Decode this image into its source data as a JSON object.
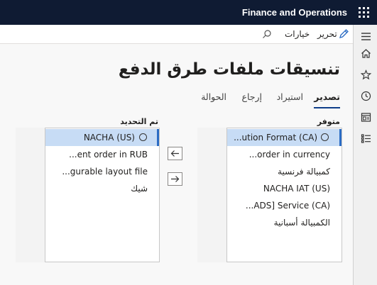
{
  "header": {
    "app_title": "Finance and Operations"
  },
  "actionbar": {
    "edit_label": "تحرير",
    "options_label": "خيارات"
  },
  "page": {
    "title": "تنسيقات ملفات طرق الدفع"
  },
  "tabs": [
    {
      "label": "تصدير",
      "active": true
    },
    {
      "label": "استيراد",
      "active": false
    },
    {
      "label": "إرجاع",
      "active": false
    },
    {
      "label": "الحوالة",
      "active": false
    }
  ],
  "available": {
    "label": "متوفر",
    "items": [
      {
        "text": "...ution Format (CA)",
        "selected": true
      },
      {
        "text": "...order in currency",
        "selected": false
      },
      {
        "text": "كمبيالة فرنسية",
        "selected": false
      },
      {
        "text": "NACHA IAT (US)",
        "selected": false
      },
      {
        "text": "...ADS] Service (CA)",
        "selected": false
      },
      {
        "text": "الكمبيالة أسبانية",
        "selected": false
      }
    ]
  },
  "setup": {
    "label": "تم التحديد",
    "items": [
      {
        "text": "NACHA (US)",
        "selected": true
      },
      {
        "text": "...ent order in RUB",
        "selected": false
      },
      {
        "text": "...gurable layout file",
        "selected": false
      },
      {
        "text": "شيك",
        "selected": false
      }
    ]
  },
  "icons": {
    "waffle": "app-launcher-icon",
    "edit": "pencil-icon",
    "search": "search-icon",
    "menu": "hamburger-icon",
    "home": "home-icon",
    "favorites": "star-icon",
    "recent": "clock-icon",
    "workspaces": "workspace-icon",
    "modules": "list-icon"
  },
  "colors": {
    "topbar": "#0f1b33",
    "selection": "#c7dcf5",
    "accent": "#0f3e8a"
  }
}
